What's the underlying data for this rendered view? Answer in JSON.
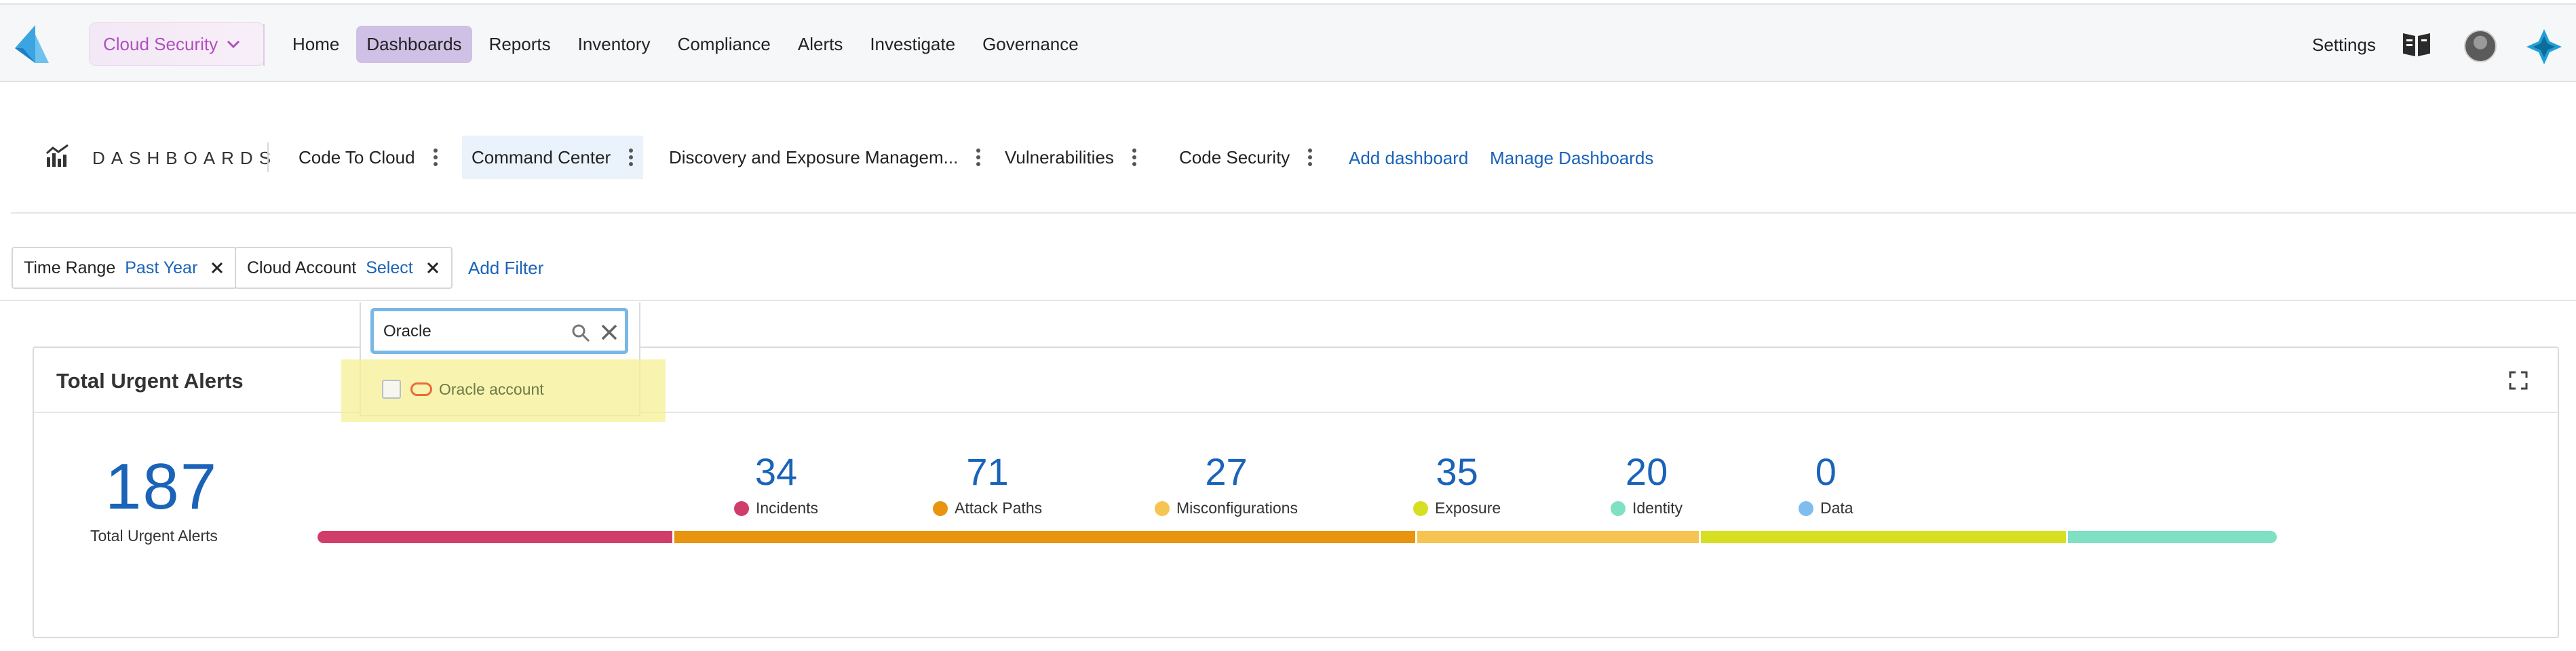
{
  "topnav": {
    "product": "Cloud Security",
    "items": [
      {
        "label": "Home",
        "active": false
      },
      {
        "label": "Dashboards",
        "active": true
      },
      {
        "label": "Reports",
        "active": false
      },
      {
        "label": "Inventory",
        "active": false
      },
      {
        "label": "Compliance",
        "active": false
      },
      {
        "label": "Alerts",
        "active": false
      },
      {
        "label": "Investigate",
        "active": false
      },
      {
        "label": "Governance",
        "active": false
      }
    ],
    "settings": "Settings"
  },
  "dashboards": {
    "title": "DASHBOARDS",
    "tabs": [
      {
        "label": "Code To Cloud",
        "active": false
      },
      {
        "label": "Command Center",
        "active": true
      },
      {
        "label": "Discovery and Exposure Managem...",
        "active": false
      },
      {
        "label": "Vulnerabilities",
        "active": false
      },
      {
        "label": "Code Security",
        "active": false
      }
    ],
    "add_dashboard": "Add dashboard",
    "manage_dashboards": "Manage Dashboards"
  },
  "filters": {
    "time_range": {
      "label": "Time Range",
      "value": "Past Year"
    },
    "cloud_account": {
      "label": "Cloud Account",
      "value": "Select"
    },
    "add_filter": "Add Filter"
  },
  "dropdown": {
    "search_value": "Oracle",
    "option_label": "Oracle account"
  },
  "card": {
    "title": "Total Urgent Alerts",
    "total": "187",
    "total_label": "Total Urgent Alerts",
    "metrics": [
      {
        "value": "34",
        "label": "Incidents",
        "color": "#d13d6b"
      },
      {
        "value": "71",
        "label": "Attack Paths",
        "color": "#e8940f"
      },
      {
        "value": "27",
        "label": "Misconfigurations",
        "color": "#f6c451"
      },
      {
        "value": "35",
        "label": "Exposure",
        "color": "#d6df22"
      },
      {
        "value": "20",
        "label": "Identity",
        "color": "#7fe0c4"
      },
      {
        "value": "0",
        "label": "Data",
        "color": "#7dbdf0"
      }
    ]
  }
}
